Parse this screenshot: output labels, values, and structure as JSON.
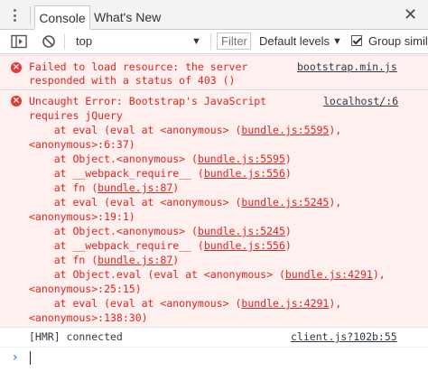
{
  "tabs": {
    "active": "Console",
    "other": "What's New"
  },
  "toolbar": {
    "context": "top",
    "filter_placeholder": "Filter",
    "levels": "Default levels",
    "group_label": "Group similar"
  },
  "messages": {
    "error1": {
      "lines": [
        "Failed to load resource: the server",
        "responded with a status of 403 ()"
      ],
      "source": "bootstrap.min.js"
    },
    "error2": {
      "source": "localhost/:6",
      "l1": "Uncaught Error: Bootstrap's JavaScript",
      "l2": "requires jQuery",
      "l3a": "    at eval (eval at <anonymous> (",
      "l3b": "bundle.js:5595",
      "l3c": "),",
      "l4": "<anonymous>:6:37)",
      "l5a": "    at Object.<anonymous> (",
      "l5b": "bundle.js:5595",
      "l5c": ")",
      "l6a": "    at __webpack_require__ (",
      "l6b": "bundle.js:556",
      "l6c": ")",
      "l7a": "    at fn (",
      "l7b": "bundle.js:87",
      "l7c": ")",
      "l8a": "    at eval (eval at <anonymous> (",
      "l8b": "bundle.js:5245",
      "l8c": "),",
      "l9": "<anonymous>:19:1)",
      "l10a": "    at Object.<anonymous> (",
      "l10b": "bundle.js:5245",
      "l10c": ")",
      "l11a": "    at __webpack_require__ (",
      "l11b": "bundle.js:556",
      "l11c": ")",
      "l12a": "    at fn (",
      "l12b": "bundle.js:87",
      "l12c": ")",
      "l13a": "    at Object.eval (eval at <anonymous> (",
      "l13b": "bundle.js:4291",
      "l13c": "),",
      "l14": "<anonymous>:25:15)",
      "l15a": "    at eval (eval at <anonymous> (",
      "l15b": "bundle.js:4291",
      "l15c": "),",
      "l16": "<anonymous>:138:30)"
    },
    "info": {
      "text": "[HMR] connected",
      "source": "client.js?102b:55"
    }
  },
  "prompt": {
    "chevron": "›"
  }
}
